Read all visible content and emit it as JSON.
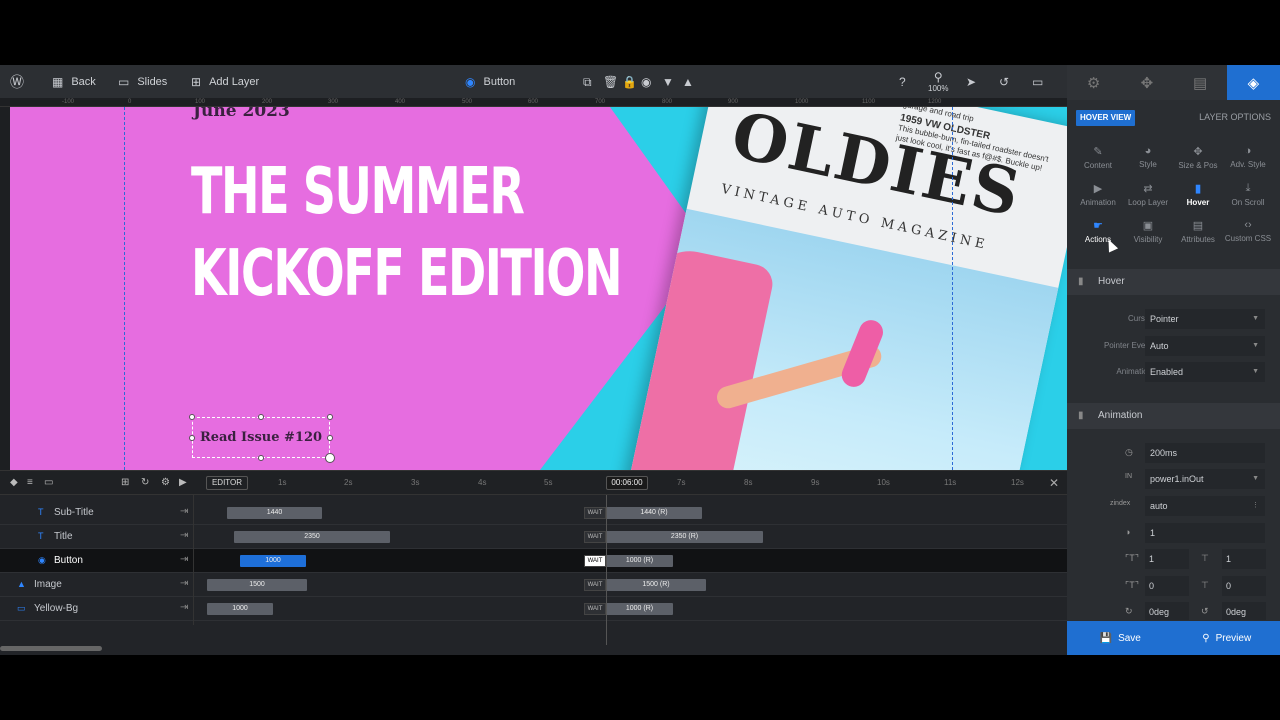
{
  "toolbar": {
    "back_label": "Back",
    "slides_label": "Slides",
    "add_layer_label": "Add Layer",
    "selected_layer": "Button",
    "zoom": "100%"
  },
  "ruler_ticks": [
    "-100",
    "0",
    "100",
    "200",
    "300",
    "400",
    "500",
    "600",
    "700",
    "800",
    "900",
    "1000",
    "1100",
    "1200"
  ],
  "canvas": {
    "subtitle": "June 2023",
    "title_line1": "THE SUMMER",
    "title_line2": "KICKOFF EDITION",
    "button_text": "Read Issue #120",
    "magazine_title": "OLDIES",
    "magazine_sub": "VINTAGE AUTO MAGAZINE",
    "magazine_blurb_title": "1959 VW OLDSTER",
    "magazine_blurb": "This bubble-bum, fin-tailed roadster doesn't just look cool, it's fast as f@#$. Buckle up!",
    "magazine_blurb_top": "garage and road trip"
  },
  "timeline": {
    "editor_label": "EDITOR",
    "time": "00:06:00",
    "ticks": [
      "1s",
      "2s",
      "3s",
      "4s",
      "5s",
      "7s",
      "8s",
      "9s",
      "10s",
      "11s",
      "12s"
    ],
    "rows": [
      {
        "name": "Sub-Title",
        "in": "1440",
        "out": "1440 (R)",
        "icon": "T"
      },
      {
        "name": "Title",
        "in": "2350",
        "out": "2350 (R)",
        "icon": "T"
      },
      {
        "name": "Button",
        "in": "1000",
        "out": "1000 (R)",
        "icon": "◉"
      },
      {
        "name": "Image",
        "in": "1500",
        "out": "1500 (R)",
        "icon": "▲"
      },
      {
        "name": "Yellow-Bg",
        "in": "1000",
        "out": "1000 (R)",
        "icon": "▭"
      }
    ],
    "wait_label": "WAIT"
  },
  "panel": {
    "hover_view": "HOVER VIEW",
    "layer_options": "LAYER OPTIONS",
    "options": [
      {
        "label": "Content",
        "icon": "✎"
      },
      {
        "label": "Style",
        "icon": "◕"
      },
      {
        "label": "Size & Pos",
        "icon": "✥"
      },
      {
        "label": "Adv. Style",
        "icon": "◑"
      },
      {
        "label": "Animation",
        "icon": "▶"
      },
      {
        "label": "Loop Layer",
        "icon": "⇄"
      },
      {
        "label": "Hover",
        "icon": "▮"
      },
      {
        "label": "On Scroll",
        "icon": "⤓"
      },
      {
        "label": "Actions",
        "icon": "☛"
      },
      {
        "label": "Visibility",
        "icon": "▣"
      },
      {
        "label": "Attributes",
        "icon": "▤"
      },
      {
        "label": "Custom CSS",
        "icon": "‹›"
      }
    ],
    "hover_section": "Hover",
    "cursor_label": "Cursor",
    "cursor_value": "Pointer",
    "pointer_event_label": "Pointer Event",
    "pointer_event_value": "Auto",
    "animation_label": "Animation",
    "animation_value": "Enabled",
    "animation_section": "Animation",
    "duration": "200ms",
    "easing_icon_label": "IN",
    "easing": "power1.inOut",
    "zindex_label": "zindex",
    "zindex": "auto",
    "opacity": "1",
    "scale_x": "1",
    "scale_y": "1",
    "skew_x": "0",
    "skew_y": "0",
    "rotate_x": "0deg",
    "rotate_y": "0deg",
    "save": "Save",
    "preview": "Preview"
  },
  "colors": {
    "canvas_pink": "#e66de0",
    "accent_blue": "#1f6fd1",
    "cyan": "#2bcfe8"
  }
}
